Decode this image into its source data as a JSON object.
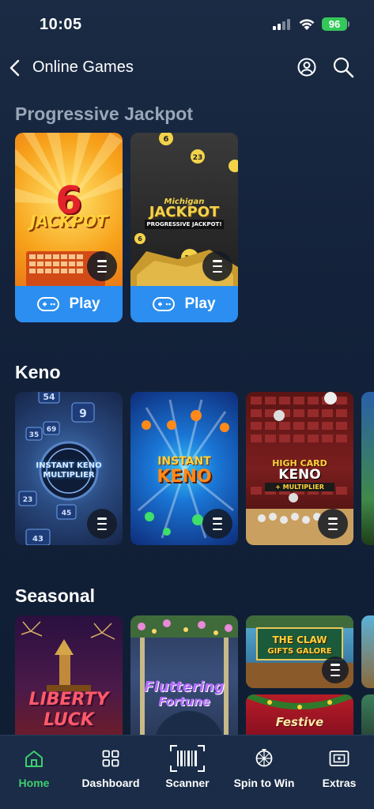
{
  "status": {
    "time": "10:05",
    "battery": "96"
  },
  "header": {
    "title": "Online Games"
  },
  "sections": {
    "progressive": {
      "title": "Progressive Jackpot"
    },
    "keno": {
      "title": "Keno"
    },
    "seasonal": {
      "title": "Seasonal"
    }
  },
  "cards": {
    "jackpot6": {
      "play": "Play",
      "art_title": "JACKPOT",
      "art_number": "6"
    },
    "michigan": {
      "play": "Play",
      "art_line1": "Michigan",
      "art_line2": "JACKPOT",
      "art_line3": "PROGRESSIVE JACKPOT!"
    },
    "instant_multiplier": {
      "art_line1": "INSTANT KENO",
      "art_line2": "MULTIPLIER"
    },
    "instant_keno": {
      "art_line1": "INSTANT",
      "art_line2": "KENO"
    },
    "highcard": {
      "art_line1": "HIGH CARD",
      "art_line2": "KENO",
      "art_line3": "+ MULTIPLIER"
    },
    "liberty": {
      "art_line1": "LIBERTY",
      "art_line2": "LUCK"
    },
    "fluttering": {
      "art_line1": "Fluttering",
      "art_line2": "Fortune"
    },
    "claw": {
      "art_line1": "THE CLAW",
      "art_line2": "GIFTS GALORE"
    },
    "festive": {
      "art_line1": "Festive"
    }
  },
  "bottom_nav": {
    "home": "Home",
    "dashboard": "Dashboard",
    "scanner": "Scanner",
    "spin": "Spin to Win",
    "extras": "Extras"
  },
  "colors": {
    "accent": "#2b8ef0",
    "active": "#3ecf6e",
    "background": "#13223a"
  }
}
